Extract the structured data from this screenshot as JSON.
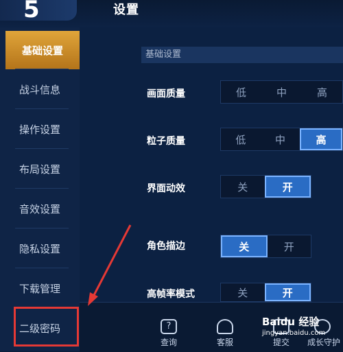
{
  "header": {
    "title": "设置"
  },
  "sidebar": {
    "items": [
      {
        "label": "基础设置"
      },
      {
        "label": "战斗信息"
      },
      {
        "label": "操作设置"
      },
      {
        "label": "布局设置"
      },
      {
        "label": "音效设置"
      },
      {
        "label": "隐私设置"
      },
      {
        "label": "下载管理"
      },
      {
        "label": "二级密码"
      }
    ],
    "active_index": 0
  },
  "main": {
    "section_title": "基础设置",
    "rows": [
      {
        "label": "画面质量",
        "options": [
          "低",
          "中",
          "高"
        ],
        "selected": null
      },
      {
        "label": "粒子质量",
        "options": [
          "低",
          "中",
          "高"
        ],
        "selected": "高"
      },
      {
        "label": "界面动效",
        "options": [
          "关",
          "开"
        ],
        "selected": "开"
      },
      {
        "label": "角色描边",
        "options": [
          "关",
          "开"
        ],
        "selected": "关"
      },
      {
        "label": "高帧率模式",
        "options": [
          "关",
          "开"
        ],
        "selected": "开"
      }
    ]
  },
  "bottom_bar": {
    "items": [
      {
        "label": "查询",
        "icon": "query-icon"
      },
      {
        "label": "客服",
        "icon": "headset-icon"
      },
      {
        "label": "提交",
        "icon": "submit-icon"
      },
      {
        "label": "成长守护",
        "icon": "guard-icon"
      }
    ]
  },
  "watermark": {
    "brand": "Baidu 经验",
    "url": "jingyan.baidu.com"
  },
  "colors": {
    "active_tab": "#d1952c",
    "selected_option": "#2a6cc4",
    "annotation": "#e53935"
  }
}
